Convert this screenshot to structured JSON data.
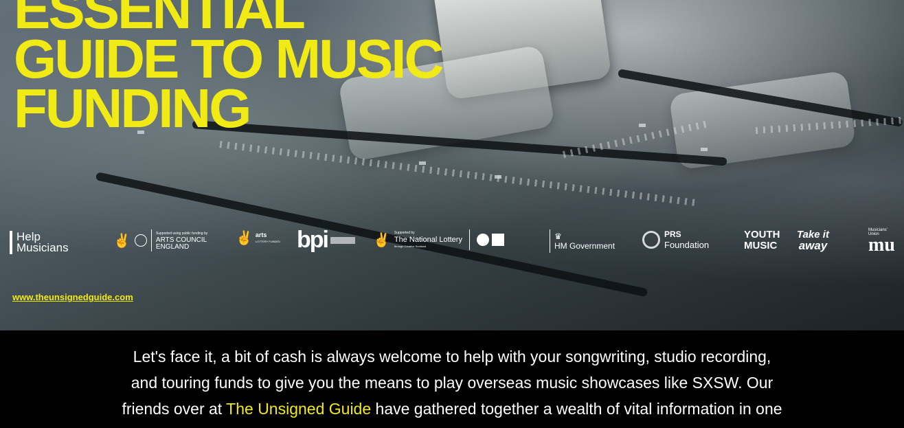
{
  "hero": {
    "title_lines": [
      "ESSENTIAL",
      "GUIDE TO MUSIC",
      "FUNDING"
    ],
    "url": "www.theunsignedguide.com"
  },
  "logos": {
    "help_musicians": "Help\nMusicians",
    "help_musicians_line1": "Help",
    "help_musicians_line2": "Musicians",
    "arts_council_small": "Supported using public funding by",
    "arts_council_line1": "ARTS COUNCIL",
    "arts_council_line2": "ENGLAND",
    "lottery_funded": "LOTTERY FUNDED",
    "arts_small": "arts",
    "bpi": "bpi",
    "national_lottery_small": "Supported by",
    "national_lottery": "The National Lottery",
    "national_lottery_sub": "through Creative Scotland",
    "hm_government": "HM Government",
    "prs_line1": "PRS",
    "prs_line2": "Foundation",
    "youth_line1": "YOUTH",
    "youth_line2": "MUSIC",
    "takeit_line1": "Take it",
    "takeit_line2": "away",
    "mu_small1": "Musicians'",
    "mu_small2": "Union",
    "mu": "mu"
  },
  "intro": {
    "line1": "Let's face it, a bit of cash is always welcome to help with your songwriting, studio recording,",
    "line2": "and touring funds to give you the means to play overseas music showcases like SXSW. Our",
    "line3_before": "friends over at ",
    "line3_link": "The Unsigned Guide",
    "line3_after": " have gathered together a wealth of vital information in one"
  },
  "colors": {
    "accent": "#f2ea14",
    "text": "#ffffff",
    "background": "#000000"
  }
}
